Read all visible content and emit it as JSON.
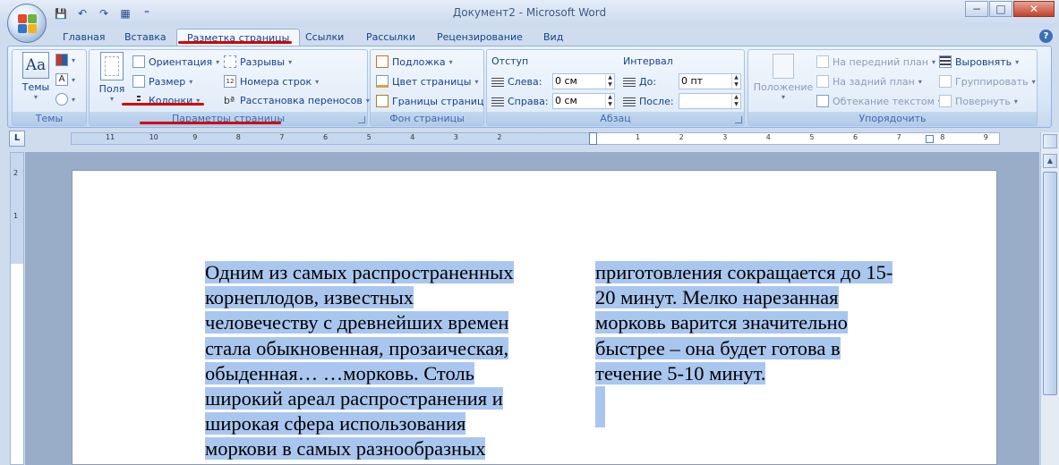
{
  "window": {
    "title": "Документ2 - Microsoft Word",
    "minimize": "−",
    "maximize": "□",
    "close": "✕"
  },
  "qat": {
    "save": "💾",
    "undo": "↶",
    "redo": "↷",
    "print": "▦",
    "customize": "⁼"
  },
  "tabs": [
    {
      "label": "Главная"
    },
    {
      "label": "Вставка"
    },
    {
      "label": "Разметка страницы",
      "active": true
    },
    {
      "label": "Ссылки"
    },
    {
      "label": "Рассылки"
    },
    {
      "label": "Рецензирование"
    },
    {
      "label": "Вид"
    }
  ],
  "help": "?",
  "ribbon": {
    "themes": {
      "label": "Темы",
      "themes_button": "Темы"
    },
    "page_setup": {
      "label": "Параметры страницы",
      "margins": "Поля",
      "orientation": "Ориентация",
      "size": "Размер",
      "columns": "Колонки",
      "breaks": "Разрывы",
      "line_numbers": "Номера строк",
      "hyphenation": "Расстановка переносов"
    },
    "page_background": {
      "label": "Фон страницы",
      "watermark": "Подложка",
      "page_color": "Цвет страницы",
      "page_borders": "Границы страниц"
    },
    "paragraph": {
      "label": "Абзац",
      "indent_title": "Отступ",
      "left_label": "Слева:",
      "left_value": "0 см",
      "right_label": "Справа:",
      "right_value": "0 см",
      "spacing_title": "Интервал",
      "before_label": "До:",
      "before_value": "0 пт",
      "after_label": "После:",
      "after_value": ""
    },
    "arrange": {
      "label": "Упорядочить",
      "position": "Положение",
      "bring_front": "На передний план",
      "send_back": "На задний план",
      "text_wrap": "Обтекание текстом",
      "align": "Выровнять",
      "group": "Группировать",
      "rotate": "Повернуть"
    }
  },
  "ruler": {
    "tab_selector": "L",
    "numbers_left": [
      "11",
      "10",
      "9",
      "8",
      "7",
      "6",
      "5",
      "4",
      "3",
      "2",
      "1"
    ],
    "numbers_right": [
      "1",
      "2",
      "3",
      "4",
      "5",
      "6",
      "7",
      "8",
      "9"
    ],
    "vertical_numbers": [
      "2",
      "1"
    ]
  },
  "document": {
    "column1": [
      "Одним из самых распространенных",
      "корнеплодов, известных",
      "человечеству с древнейших времен",
      "стала обыкновенная, прозаическая,",
      "обыденная… …морковь. Столь",
      "широкий ареал распространения и",
      "широкая сфера использования",
      "моркови в самых разнообразных"
    ],
    "column2": [
      "приготовления сокращается до 15-",
      "20 минут. Мелко нарезанная",
      "морковь варится значительно",
      "быстрее – она будет готова в",
      "течение 5-10 минут."
    ]
  },
  "scrollbar": {
    "up": "▲"
  },
  "colors": {
    "accent": "#15428b",
    "selection": "#a9c6ee",
    "annotation": "#d40000"
  }
}
